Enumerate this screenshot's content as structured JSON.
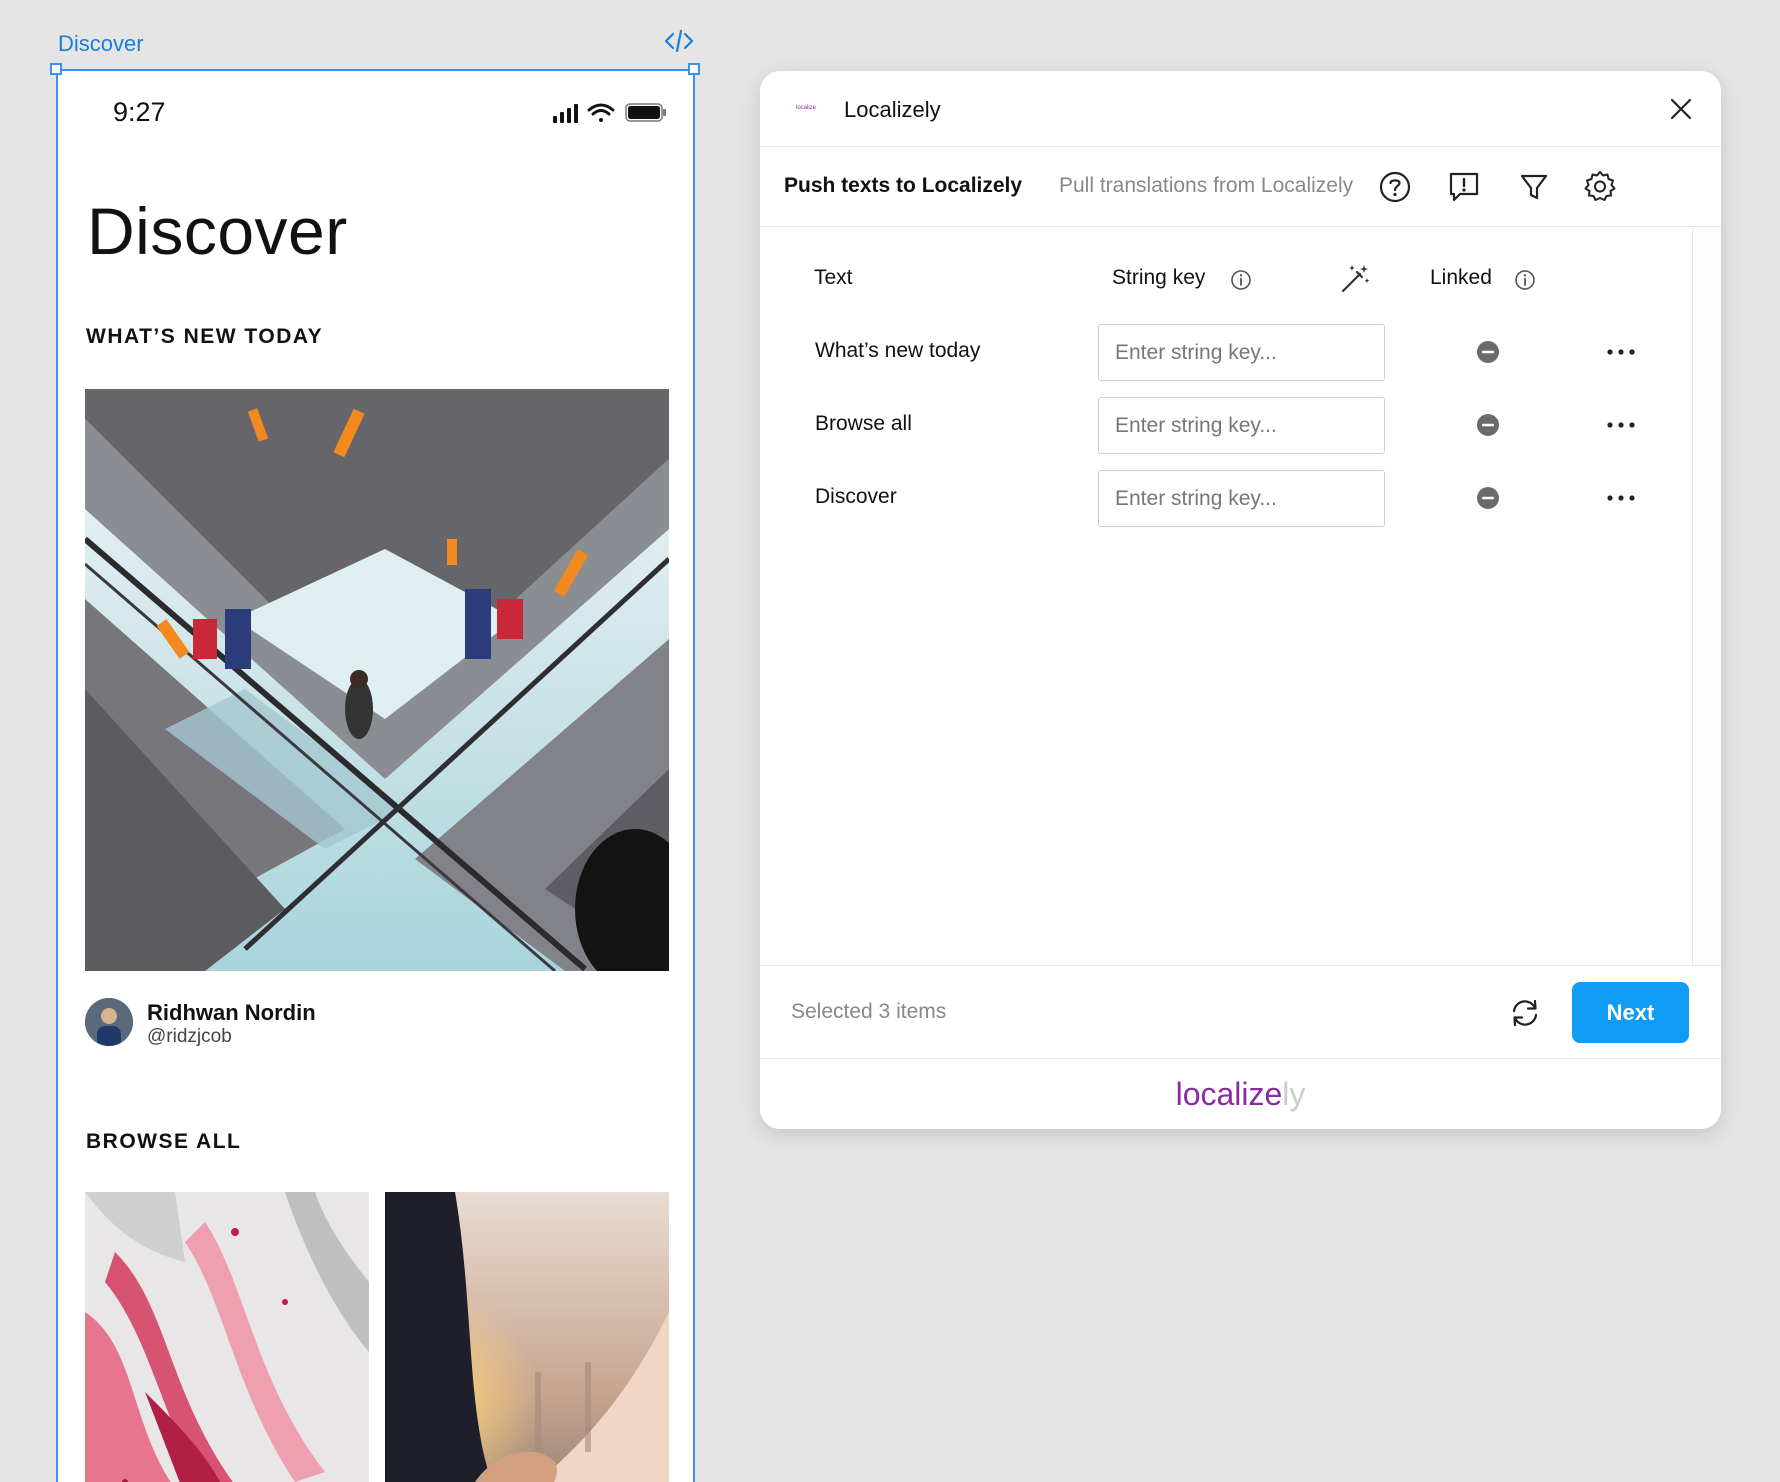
{
  "canvas": {
    "frame_label": "Discover"
  },
  "phone": {
    "status": {
      "time": "9:27"
    },
    "title": "Discover",
    "sections": {
      "whats_new": "WHAT’S NEW TODAY",
      "browse_all": "BROWSE ALL"
    },
    "author": {
      "name": "Ridhwan Nordin",
      "handle": "@ridzjcob"
    }
  },
  "plugin": {
    "logo_text": "localize",
    "title": "Localizely",
    "tabs": [
      {
        "label": "Push texts to Localizely",
        "active": true
      },
      {
        "label": "Pull translations from Localizely",
        "active": false
      }
    ],
    "toolbar_icons": [
      "help-icon",
      "feedback-icon",
      "filter-icon",
      "settings-icon"
    ],
    "columns": {
      "text": "Text",
      "string_key": "String key",
      "linked": "Linked"
    },
    "rows": [
      {
        "text": "What’s new today",
        "placeholder": "Enter string key..."
      },
      {
        "text": "Browse all",
        "placeholder": "Enter string key..."
      },
      {
        "text": "Discover",
        "placeholder": "Enter string key..."
      }
    ],
    "footer": {
      "selected": "Selected 3 items",
      "next_label": "Next"
    },
    "brand": {
      "main": "localize",
      "faint": "ly"
    },
    "colors": {
      "accent": "#109cf5",
      "brand": "#8b2aa3",
      "selection": "#3d8ff0"
    }
  }
}
